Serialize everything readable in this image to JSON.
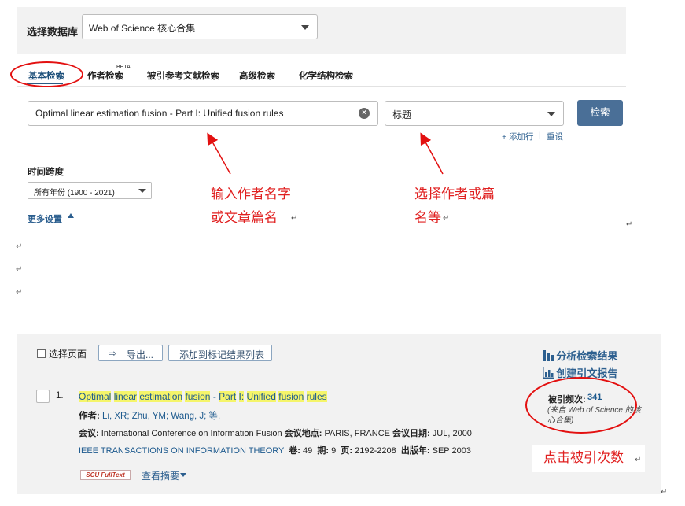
{
  "database": {
    "label": "选择数据库",
    "selected": "Web of Science 核心合集"
  },
  "tabs": {
    "basic": "基本检索",
    "author": "作者检索",
    "author_badge": "BETA",
    "cited": "被引参考文献检索",
    "advanced": "高级检索",
    "chemical": "化学结构检索"
  },
  "search": {
    "query": "Optimal linear estimation fusion - Part I: Unified fusion rules",
    "clear_icon": "×",
    "field": "标题",
    "button": "检索",
    "add_row": "+ 添加行",
    "separator": "|",
    "reset": "重设"
  },
  "timespan": {
    "label": "时间跨度",
    "value": "所有年份 (1900 - 2021)",
    "more_settings": "更多设置"
  },
  "annotations": {
    "note1_line1": "输入作者名字",
    "note1_line2": "或文章篇名",
    "note2_line1": "选择作者或篇",
    "note2_line2": "名等",
    "note3": "点击被引次数",
    "paragraph_mark": "↵"
  },
  "toolbar": {
    "select_page": "选择页面",
    "export_icon": "⇨",
    "export": "导出...",
    "add_to_marked": "添加到标记结果列表",
    "analyze": "分析检索结果",
    "citation_report": "创建引文报告"
  },
  "record": {
    "number": "1.",
    "title_parts": [
      "Optimal",
      "linear",
      "estimation",
      "fusion",
      "-",
      "Part",
      "I:",
      "Unified",
      "fusion",
      "rules"
    ],
    "authors_label": "作者:",
    "authors": "Li, XR; Zhu, YM; Wang, J; 等.",
    "conference_label": "会议:",
    "conference": "International Conference on Information Fusion",
    "location_label": "会议地点:",
    "location": "PARIS, FRANCE",
    "date_label": "会议日期:",
    "date": "JUL, 2000",
    "journal": "IEEE TRANSACTIONS ON INFORMATION THEORY",
    "volume_label": "卷:",
    "volume": "49",
    "issue_label": "期:",
    "issue": "9",
    "pages_label": "页:",
    "pages": "2192-2208",
    "year_label": "出版年:",
    "year": "SEP 2003",
    "fulltext": "SCU FullText",
    "view_abstract": "查看摘要",
    "times_cited_label": "被引频次:",
    "times_cited": "341",
    "times_cited_note": "(来自 Web of Science 的核心合集)"
  },
  "colors": {
    "accent": "#4a6f97",
    "link": "#2c5f8f",
    "annotation": "#e02020",
    "highlight": "#f5f56a"
  }
}
